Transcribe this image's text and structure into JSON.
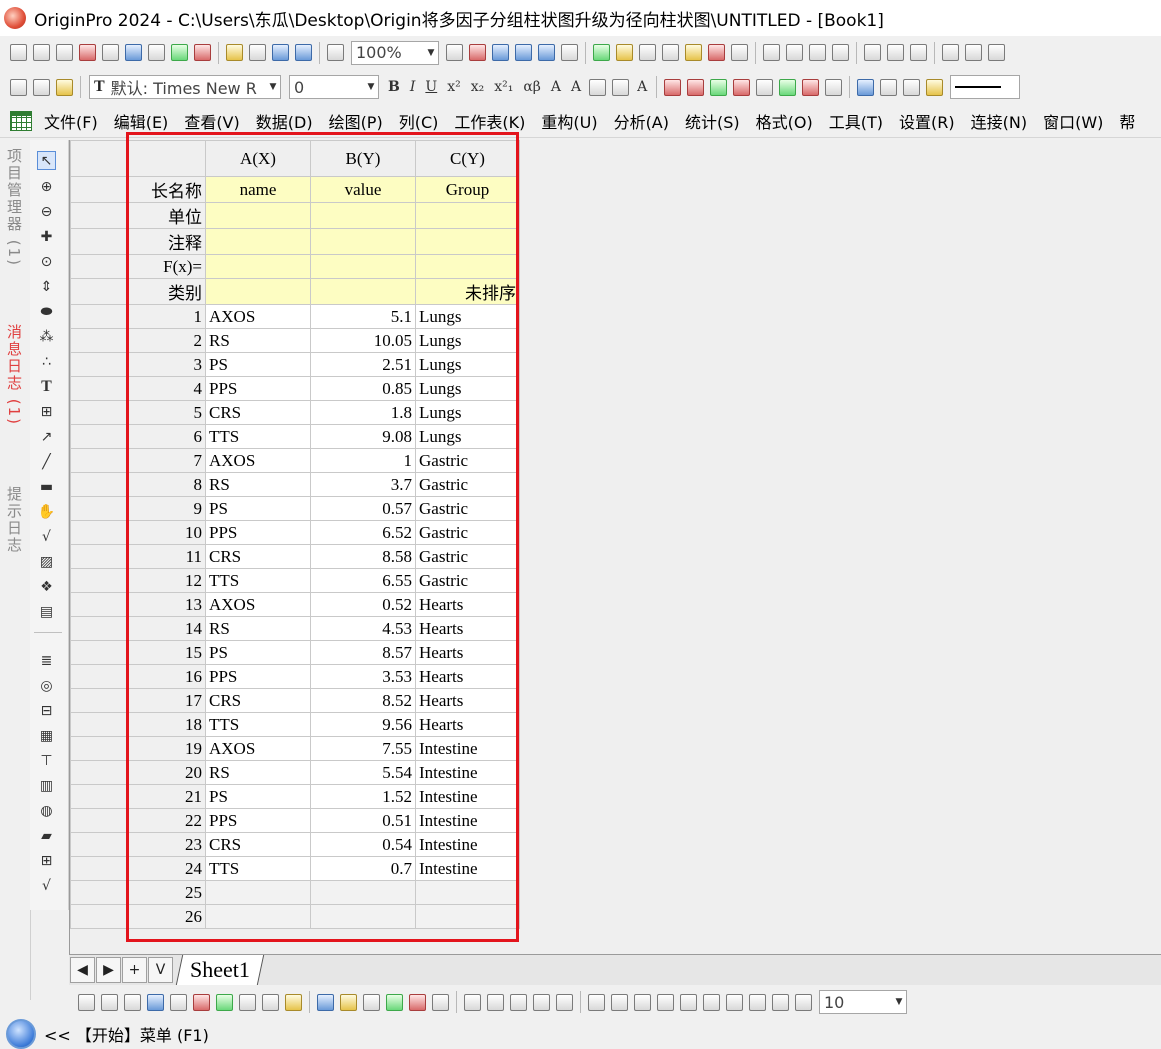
{
  "window": {
    "title": "OriginPro 2024 - C:\\Users\\东瓜\\Desktop\\Origin将多因子分组柱状图升级为径向柱状图\\UNTITLED - [Book1]"
  },
  "toolbar1": {
    "zoom_value": "100%"
  },
  "toolbar2": {
    "font_value": "默认: Times New R",
    "size_value": "0",
    "greek_label": "αβ"
  },
  "toolbar3": {
    "size_value": "10"
  },
  "menu": [
    "文件(F)",
    "编辑(E)",
    "查看(V)",
    "数据(D)",
    "绘图(P)",
    "列(C)",
    "工作表(K)",
    "重构(U)",
    "分析(A)",
    "统计(S)",
    "格式(O)",
    "工具(T)",
    "设置(R)",
    "连接(N)",
    "窗口(W)",
    "帮"
  ],
  "dock_tabs": {
    "project": "项目管理器 (1)",
    "messages": "消息日志 (1)",
    "hints": "提示日志"
  },
  "worksheet": {
    "columns": [
      "A(X)",
      "B(Y)",
      "C(Y)"
    ],
    "meta_labels": {
      "long_name": "长名称",
      "units": "单位",
      "comments": "注释",
      "fx": "F(x)=",
      "category": "类别"
    },
    "long_names": [
      "name",
      "value",
      "Group"
    ],
    "category_c": "未排序",
    "rows": [
      {
        "n": "1",
        "a": "AXOS",
        "b": "5.1",
        "c": "Lungs"
      },
      {
        "n": "2",
        "a": "RS",
        "b": "10.05",
        "c": "Lungs"
      },
      {
        "n": "3",
        "a": "PS",
        "b": "2.51",
        "c": "Lungs"
      },
      {
        "n": "4",
        "a": "PPS",
        "b": "0.85",
        "c": "Lungs"
      },
      {
        "n": "5",
        "a": "CRS",
        "b": "1.8",
        "c": "Lungs"
      },
      {
        "n": "6",
        "a": "TTS",
        "b": "9.08",
        "c": "Lungs"
      },
      {
        "n": "7",
        "a": "AXOS",
        "b": "1",
        "c": "Gastric"
      },
      {
        "n": "8",
        "a": "RS",
        "b": "3.7",
        "c": "Gastric"
      },
      {
        "n": "9",
        "a": "PS",
        "b": "0.57",
        "c": "Gastric"
      },
      {
        "n": "10",
        "a": "PPS",
        "b": "6.52",
        "c": "Gastric"
      },
      {
        "n": "11",
        "a": "CRS",
        "b": "8.58",
        "c": "Gastric"
      },
      {
        "n": "12",
        "a": "TTS",
        "b": "6.55",
        "c": "Gastric"
      },
      {
        "n": "13",
        "a": "AXOS",
        "b": "0.52",
        "c": "Hearts"
      },
      {
        "n": "14",
        "a": "RS",
        "b": "4.53",
        "c": "Hearts"
      },
      {
        "n": "15",
        "a": "PS",
        "b": "8.57",
        "c": "Hearts"
      },
      {
        "n": "16",
        "a": "PPS",
        "b": "3.53",
        "c": "Hearts"
      },
      {
        "n": "17",
        "a": "CRS",
        "b": "8.52",
        "c": "Hearts"
      },
      {
        "n": "18",
        "a": "TTS",
        "b": "9.56",
        "c": "Hearts"
      },
      {
        "n": "19",
        "a": "AXOS",
        "b": "7.55",
        "c": "Intestine"
      },
      {
        "n": "20",
        "a": "RS",
        "b": "5.54",
        "c": "Intestine"
      },
      {
        "n": "21",
        "a": "PS",
        "b": "1.52",
        "c": "Intestine"
      },
      {
        "n": "22",
        "a": "PPS",
        "b": "0.51",
        "c": "Intestine"
      },
      {
        "n": "23",
        "a": "CRS",
        "b": "0.54",
        "c": "Intestine"
      },
      {
        "n": "24",
        "a": "TTS",
        "b": "0.7",
        "c": "Intestine"
      }
    ],
    "empty_rows": [
      "25",
      "26"
    ]
  },
  "sheet_tab": {
    "label": "Sheet1",
    "plus": "+",
    "more": "V",
    "prev": "◀",
    "next": "▶"
  },
  "status": {
    "text": "<< 【开始】菜单 (F1)"
  },
  "colors": {
    "highlight_box": "#e3141c",
    "meta_row_bg": "#fdfdc2"
  }
}
